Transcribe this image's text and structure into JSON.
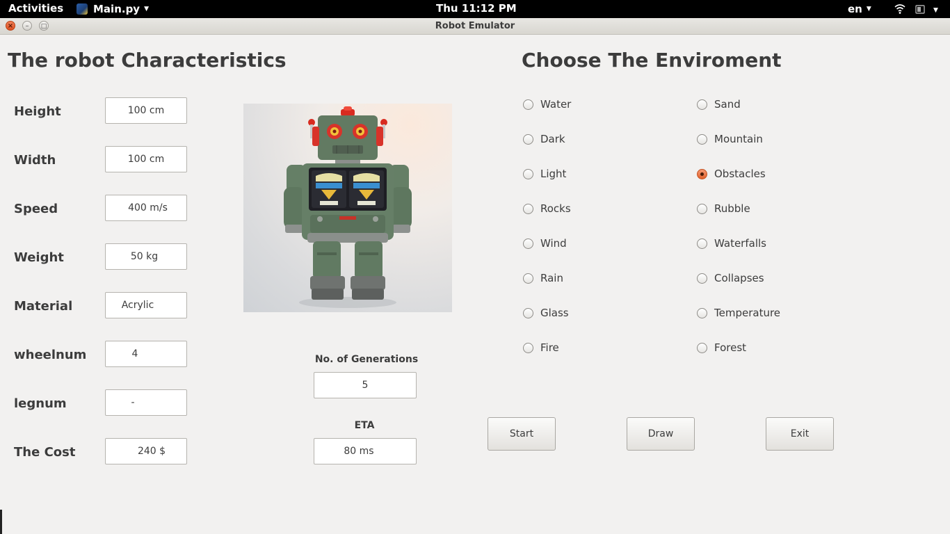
{
  "topbar": {
    "activities": "Activities",
    "app_name": "Main.py",
    "clock": "Thu 11:12 PM",
    "language": "en"
  },
  "window": {
    "title": "Robot Emulator"
  },
  "characteristics": {
    "heading": "The robot Characteristics",
    "fields": [
      {
        "label": "Height",
        "value": "100 cm"
      },
      {
        "label": "Width",
        "value": "100 cm"
      },
      {
        "label": "Speed",
        "value": "400 m/s"
      },
      {
        "label": "Weight",
        "value": "50 kg"
      },
      {
        "label": "Material",
        "value": "Acrylic"
      },
      {
        "label": "wheelnum",
        "value": "4"
      },
      {
        "label": "legnum",
        "value": "-"
      },
      {
        "label": "The Cost",
        "value": "240 $"
      }
    ]
  },
  "robot_image": {
    "icon": "robot-toy-image"
  },
  "generations": {
    "label": "No. of Generations",
    "value": "5"
  },
  "eta": {
    "label": "ETA",
    "value": "80 ms"
  },
  "environment": {
    "heading": "Choose The Enviroment",
    "selected": "Obstacles",
    "left_options": [
      "Water",
      "Dark",
      "Light",
      "Rocks",
      "Wind",
      "Rain",
      "Glass",
      "Fire"
    ],
    "right_options": [
      "Sand",
      "Mountain",
      "Obstacles",
      "Rubble",
      "Waterfalls",
      "Collapses",
      "Temperature",
      "Forest"
    ]
  },
  "actions": {
    "start": "Start",
    "draw": "Draw",
    "exit": "Exit"
  },
  "colors": {
    "accent": "#e0622c",
    "background": "#f2f1f0",
    "topbar": "#000000"
  }
}
